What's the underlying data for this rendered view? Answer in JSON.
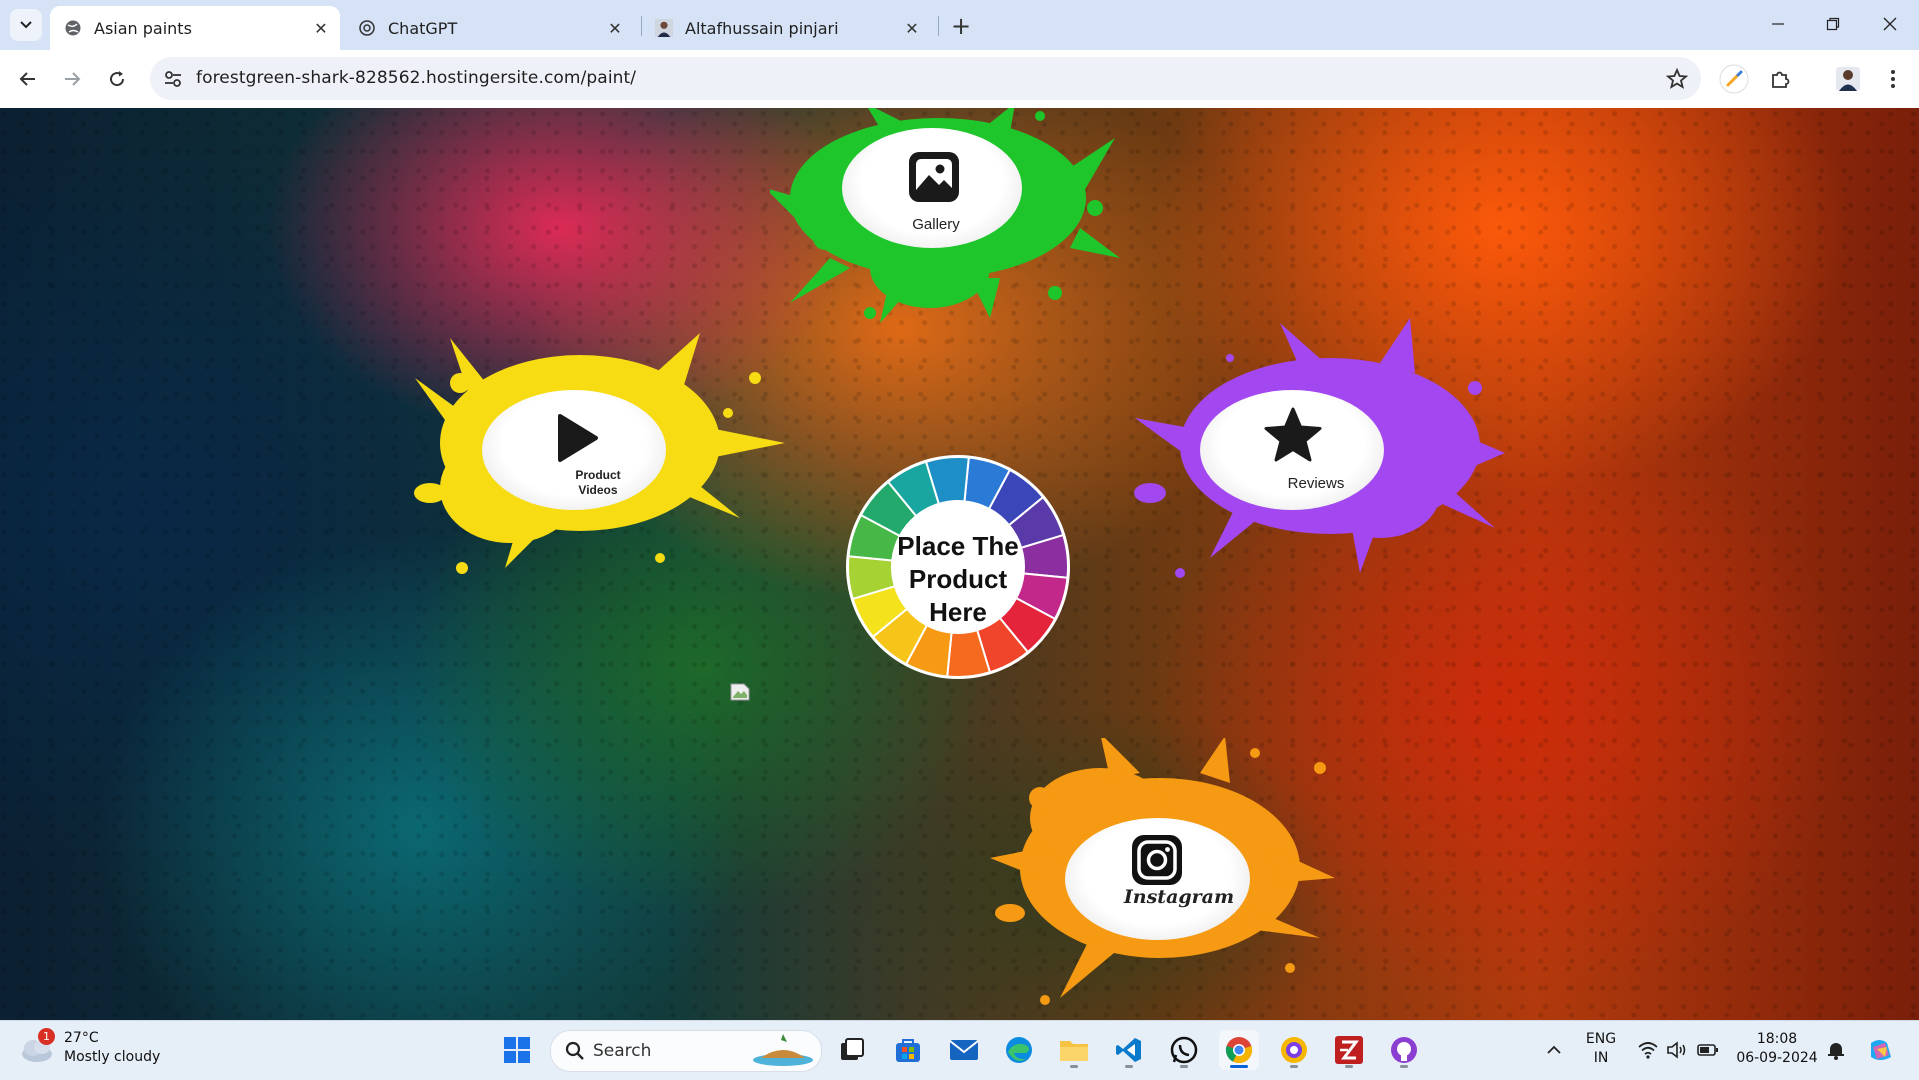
{
  "browser": {
    "tabs": [
      {
        "title": "Asian paints",
        "active": true,
        "icon": "globe-icon"
      },
      {
        "title": "ChatGPT",
        "active": false,
        "icon": "chatgpt-icon"
      },
      {
        "title": "Altafhussain pinjari",
        "active": false,
        "icon": "profile-photo-icon"
      }
    ],
    "url": "forestgreen-shark-828562.hostingersite.com/paint/"
  },
  "page": {
    "splashes": {
      "gallery": {
        "label": "Gallery",
        "color": "#1fc62b",
        "icon": "image-icon"
      },
      "product_videos": {
        "label_line1": "Product",
        "label_line2": "Videos",
        "color": "#f7dc14",
        "icon": "play-icon"
      },
      "reviews": {
        "label": "Reviews",
        "color": "#a347f0",
        "icon": "star-icon"
      },
      "instagram": {
        "label": "Instagram",
        "color": "#f79a13",
        "icon": "instagram-icon"
      }
    },
    "center": {
      "line1": "Place The",
      "line2": "Product",
      "line3": "Here"
    }
  },
  "taskbar": {
    "weather": {
      "temp": "27°C",
      "condition": "Mostly cloudy",
      "badge": "1"
    },
    "search_label": "Search",
    "language": {
      "line1": "ENG",
      "line2": "IN"
    },
    "time": "18:08",
    "date": "06-09-2024"
  }
}
